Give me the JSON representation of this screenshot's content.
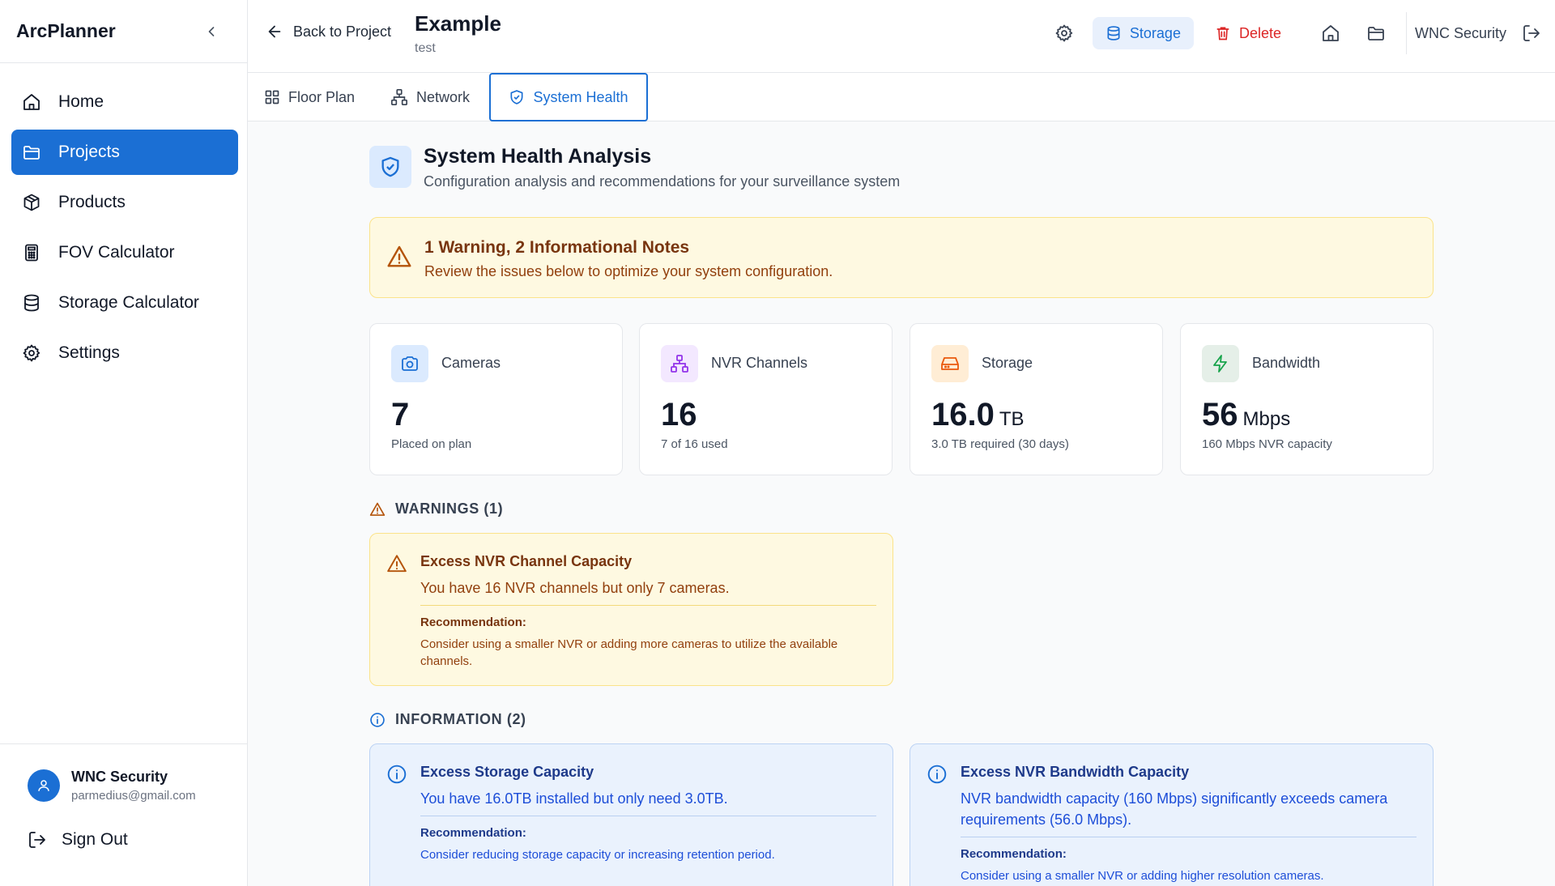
{
  "app": {
    "name": "ArcPlanner"
  },
  "sidebar": {
    "items": [
      {
        "label": "Home",
        "icon": "home-icon"
      },
      {
        "label": "Projects",
        "icon": "folder-icon",
        "active": true
      },
      {
        "label": "Products",
        "icon": "box-icon"
      },
      {
        "label": "FOV Calculator",
        "icon": "calculator-icon"
      },
      {
        "label": "Storage Calculator",
        "icon": "database-icon"
      },
      {
        "label": "Settings",
        "icon": "gear-icon"
      }
    ],
    "user": {
      "name": "WNC Security",
      "email": "parmedius@gmail.com"
    },
    "sign_out": "Sign Out"
  },
  "header": {
    "back_label": "Back to Project",
    "project_title": "Example",
    "project_subtitle": "test",
    "storage_label": "Storage",
    "delete_label": "Delete",
    "org_name": "WNC Security"
  },
  "tabs": [
    {
      "label": "Floor Plan",
      "icon": "grid-icon"
    },
    {
      "label": "Network",
      "icon": "network-icon"
    },
    {
      "label": "System Health",
      "icon": "shield-check-icon",
      "active": true
    }
  ],
  "health": {
    "title": "System Health Analysis",
    "subtitle": "Configuration analysis and recommendations for your surveillance system",
    "summary": {
      "title": "1 Warning, 2 Informational Notes",
      "subtitle": "Review the issues below to optimize your system configuration."
    },
    "cards": [
      {
        "label": "Cameras",
        "value": "7",
        "unit": "",
        "sub": "Placed on plan",
        "icon": "camera-icon",
        "color": "#1b6fd4",
        "bg": "#dbeafe"
      },
      {
        "label": "NVR Channels",
        "value": "16",
        "unit": "",
        "sub": "7 of 16 used",
        "icon": "network-icon",
        "color": "#9333ea",
        "bg": "#f3e8ff"
      },
      {
        "label": "Storage",
        "value": "16.0",
        "unit": "TB",
        "sub": "3.0 TB required (30 days)",
        "icon": "hard-drive-icon",
        "color": "#ea580c",
        "bg": "#ffedd5"
      },
      {
        "label": "Bandwidth",
        "value": "56",
        "unit": "Mbps",
        "sub": "160 Mbps NVR capacity",
        "icon": "lightning-icon",
        "color": "#16a34a",
        "bg": "#e5efe8"
      }
    ],
    "warnings_header": "WARNINGS (1)",
    "warnings": [
      {
        "title": "Excess NVR Channel Capacity",
        "description": "You have 16 NVR channels but only 7 cameras.",
        "rec_label": "Recommendation:",
        "recommendation": "Consider using a smaller NVR or adding more cameras to utilize the available channels."
      }
    ],
    "info_header": "INFORMATION (2)",
    "info": [
      {
        "title": "Excess Storage Capacity",
        "description": "You have 16.0TB installed but only need 3.0TB.",
        "rec_label": "Recommendation:",
        "recommendation": "Consider reducing storage capacity or increasing retention period."
      },
      {
        "title": "Excess NVR Bandwidth Capacity",
        "description": "NVR bandwidth capacity (160 Mbps) significantly exceeds camera requirements (56.0 Mbps).",
        "rec_label": "Recommendation:",
        "recommendation": "Consider using a smaller NVR or adding higher resolution cameras."
      }
    ]
  },
  "colors": {
    "accent": "#1b6fd4",
    "warning": "#b45309",
    "danger": "#dc2626"
  }
}
